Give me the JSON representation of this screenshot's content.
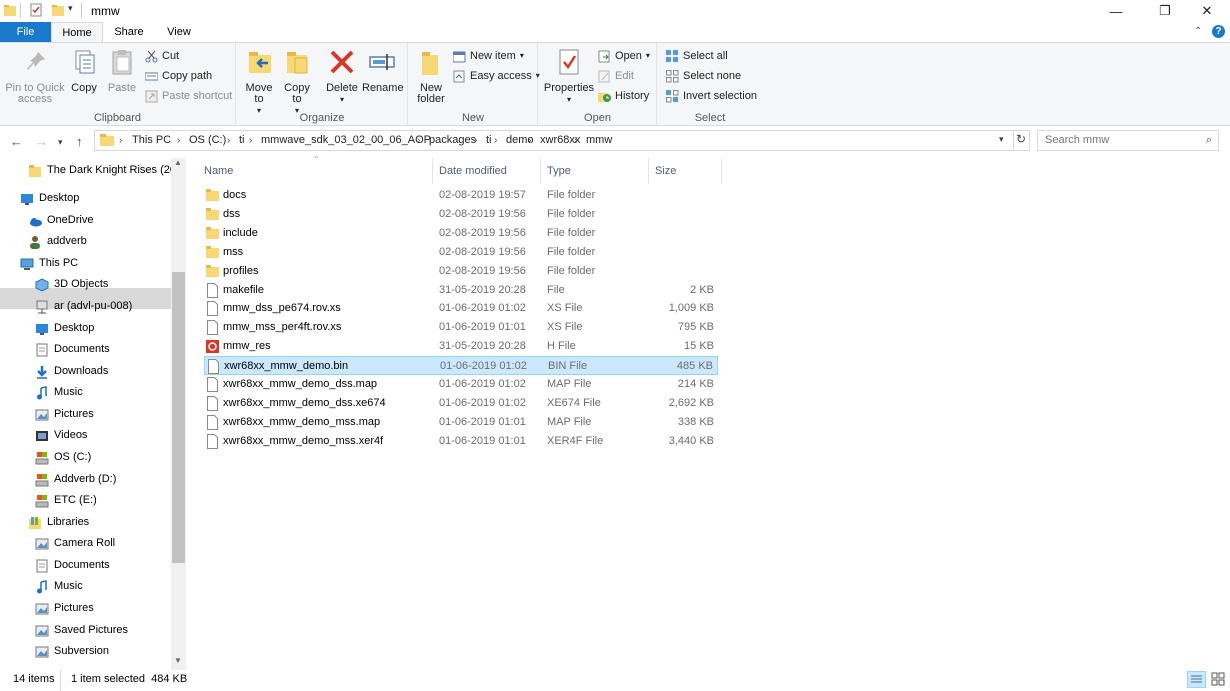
{
  "window": {
    "title": "mmw",
    "minimize": "—",
    "maximize": "❐",
    "close": "✕"
  },
  "tabs": {
    "file": "File",
    "home": "Home",
    "share": "Share",
    "view": "View"
  },
  "ribbon": {
    "clipboard": {
      "label": "Clipboard",
      "pin": "Pin to Quick access",
      "copy": "Copy",
      "paste": "Paste",
      "cut": "Cut",
      "copy_path": "Copy path",
      "paste_shortcut": "Paste shortcut"
    },
    "organize": {
      "label": "Organize",
      "move_to": "Move to",
      "copy_to": "Copy to",
      "delete": "Delete",
      "rename": "Rename"
    },
    "new": {
      "label": "New",
      "new_folder": "New folder",
      "new_item": "New item",
      "easy_access": "Easy access"
    },
    "open": {
      "label": "Open",
      "properties": "Properties",
      "open": "Open",
      "edit": "Edit",
      "history": "History"
    },
    "select": {
      "label": "Select",
      "select_all": "Select all",
      "select_none": "Select none",
      "invert": "Invert selection"
    }
  },
  "address": {
    "crumbs": [
      "This PC",
      "OS (C:)",
      "ti",
      "mmwave_sdk_03_02_00_06_AOP",
      "packages",
      "ti",
      "demo",
      "xwr68xx",
      "mmw"
    ],
    "search_placeholder": "Search mmw"
  },
  "nav": [
    {
      "label": "The Dark Knight Rises (20",
      "icon": "folder-icon"
    },
    {
      "label": "Desktop",
      "icon": "desktop-icon"
    },
    {
      "label": "OneDrive",
      "icon": "cloud-icon"
    },
    {
      "label": "addverb",
      "icon": "user-icon"
    },
    {
      "label": "This PC",
      "icon": "computer-icon"
    },
    {
      "label": "3D Objects",
      "icon": "cube-icon"
    },
    {
      "label": "ar (advl-pu-008)",
      "icon": "network-drive-icon"
    },
    {
      "label": "Desktop",
      "icon": "desktop-icon"
    },
    {
      "label": "Documents",
      "icon": "documents-icon"
    },
    {
      "label": "Downloads",
      "icon": "download-icon"
    },
    {
      "label": "Music",
      "icon": "music-icon"
    },
    {
      "label": "Pictures",
      "icon": "pictures-icon"
    },
    {
      "label": "Videos",
      "icon": "videos-icon"
    },
    {
      "label": "OS (C:)",
      "icon": "drive-icon"
    },
    {
      "label": "Addverb (D:)",
      "icon": "drive-icon"
    },
    {
      "label": "ETC (E:)",
      "icon": "drive-icon"
    },
    {
      "label": "Libraries",
      "icon": "library-icon"
    },
    {
      "label": "Camera Roll",
      "icon": "pictures-icon"
    },
    {
      "label": "Documents",
      "icon": "documents-icon"
    },
    {
      "label": "Music",
      "icon": "music-icon"
    },
    {
      "label": "Pictures",
      "icon": "pictures-icon"
    },
    {
      "label": "Saved Pictures",
      "icon": "pictures-icon"
    },
    {
      "label": "Subversion",
      "icon": "pictures-icon"
    }
  ],
  "columns": {
    "name": "Name",
    "date": "Date modified",
    "type": "Type",
    "size": "Size"
  },
  "files": [
    {
      "name": "docs",
      "date": "02-08-2019 19:57",
      "type": "File folder",
      "size": "",
      "icon": "folder-icon"
    },
    {
      "name": "dss",
      "date": "02-08-2019 19:56",
      "type": "File folder",
      "size": "",
      "icon": "folder-icon"
    },
    {
      "name": "include",
      "date": "02-08-2019 19:56",
      "type": "File folder",
      "size": "",
      "icon": "folder-icon"
    },
    {
      "name": "mss",
      "date": "02-08-2019 19:56",
      "type": "File folder",
      "size": "",
      "icon": "folder-icon"
    },
    {
      "name": "profiles",
      "date": "02-08-2019 19:56",
      "type": "File folder",
      "size": "",
      "icon": "folder-icon"
    },
    {
      "name": "makefile",
      "date": "31-05-2019 20:28",
      "type": "File",
      "size": "2 KB",
      "icon": "file-icon"
    },
    {
      "name": "mmw_dss_pe674.rov.xs",
      "date": "01-06-2019 01:02",
      "type": "XS File",
      "size": "1,009 KB",
      "icon": "file-icon"
    },
    {
      "name": "mmw_mss_per4ft.rov.xs",
      "date": "01-06-2019 01:01",
      "type": "XS File",
      "size": "795 KB",
      "icon": "file-icon"
    },
    {
      "name": "mmw_res",
      "date": "31-05-2019 20:28",
      "type": "H File",
      "size": "15 KB",
      "icon": "header-file-icon"
    },
    {
      "name": "xwr68xx_mmw_demo.bin",
      "date": "01-06-2019 01:02",
      "type": "BIN File",
      "size": "485 KB",
      "icon": "file-icon"
    },
    {
      "name": "xwr68xx_mmw_demo_dss.map",
      "date": "01-06-2019 01:02",
      "type": "MAP File",
      "size": "214 KB",
      "icon": "file-icon"
    },
    {
      "name": "xwr68xx_mmw_demo_dss.xe674",
      "date": "01-06-2019 01:02",
      "type": "XE674 File",
      "size": "2,692 KB",
      "icon": "file-icon"
    },
    {
      "name": "xwr68xx_mmw_demo_mss.map",
      "date": "01-06-2019 01:01",
      "type": "MAP File",
      "size": "338 KB",
      "icon": "file-icon"
    },
    {
      "name": "xwr68xx_mmw_demo_mss.xer4f",
      "date": "01-06-2019 01:01",
      "type": "XER4F File",
      "size": "3,440 KB",
      "icon": "file-icon"
    }
  ],
  "status": {
    "count": "14 items",
    "selection": "1 item selected  484 KB"
  },
  "colors": {
    "accent": "#1979ca",
    "selection": "#cce8ff",
    "selection_border": "#99d1ff",
    "nav_selected": "#d9d9d9"
  }
}
